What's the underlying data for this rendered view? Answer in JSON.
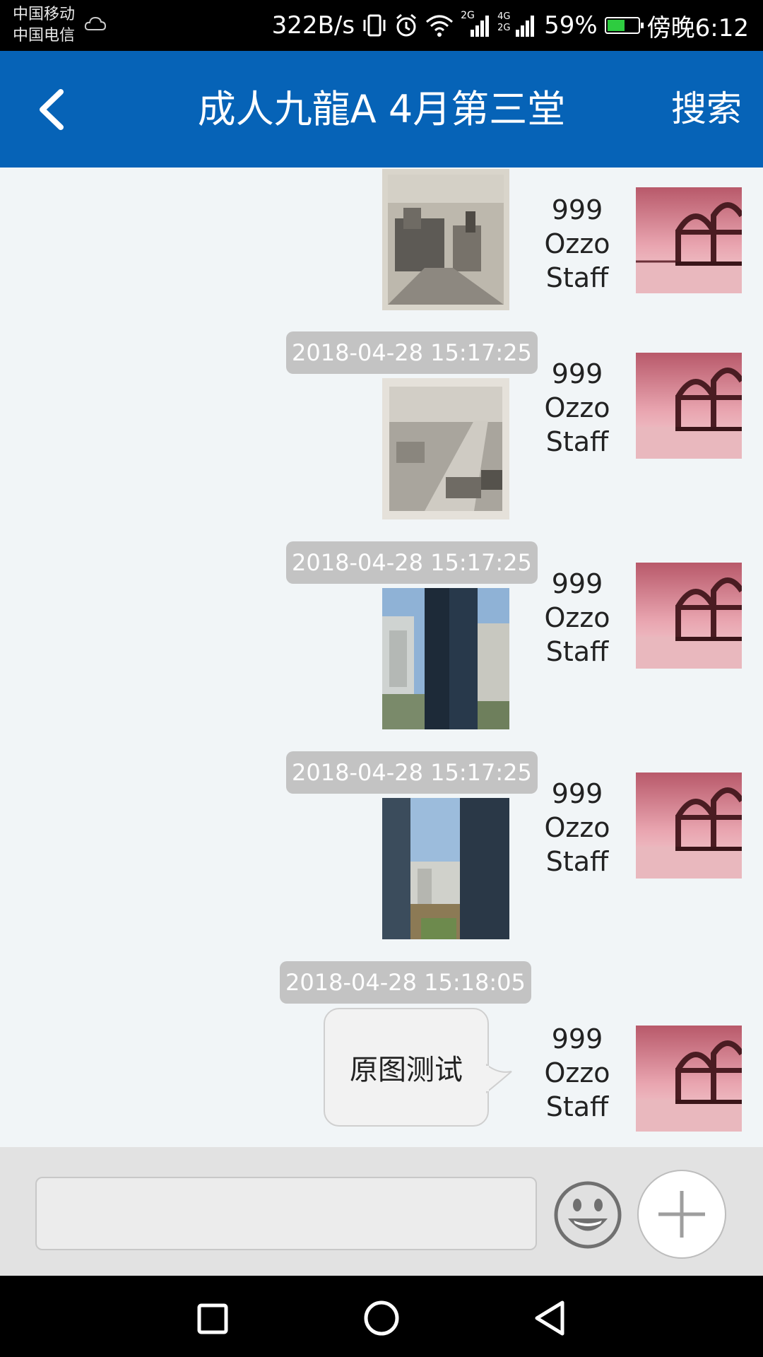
{
  "status_bar": {
    "carrier_1": "中国移动",
    "carrier_2": "中国电信",
    "net_speed": "322B/s",
    "signal_1_label": "2G",
    "signal_2_label": "4G 2G",
    "battery_percent": "59%",
    "battery_level": 0.59,
    "time": "傍晚6:12"
  },
  "header": {
    "title": "成人九龍A 4月第三堂",
    "search_label": "搜索"
  },
  "messages": [
    {
      "timestamp": "",
      "sender_line1": "999",
      "sender_line2": "Ozzo",
      "sender_line3": "Staff",
      "type": "image"
    },
    {
      "timestamp": "2018-04-28 15:17:25",
      "sender_line1": "999",
      "sender_line2": "Ozzo",
      "sender_line3": "Staff",
      "type": "image"
    },
    {
      "timestamp": "2018-04-28 15:17:25",
      "sender_line1": "999",
      "sender_line2": "Ozzo",
      "sender_line3": "Staff",
      "type": "image"
    },
    {
      "timestamp": "2018-04-28 15:17:25",
      "sender_line1": "999",
      "sender_line2": "Ozzo",
      "sender_line3": "Staff",
      "type": "image"
    },
    {
      "timestamp": "2018-04-28 15:18:05",
      "sender_line1": "999",
      "sender_line2": "Ozzo",
      "sender_line3": "Staff",
      "type": "text",
      "text": "原图测试"
    }
  ],
  "input_bar": {
    "value": "",
    "placeholder": ""
  },
  "colors": {
    "header_blue": "#0663b7",
    "chat_background": "#f1f5f7",
    "timestamp_gray": "#c3c3c3"
  },
  "icons": [
    "back-chevron-icon",
    "emoji-icon",
    "plus-icon",
    "recent-apps-icon",
    "home-icon",
    "back-triangle-icon"
  ]
}
